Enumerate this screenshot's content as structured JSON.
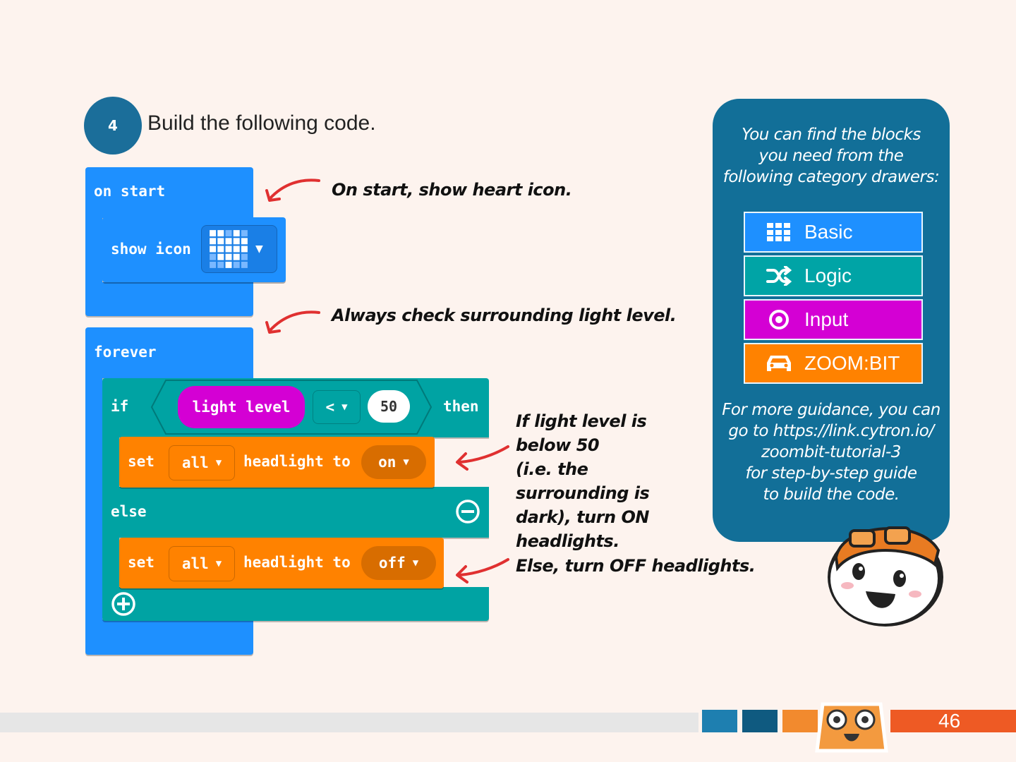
{
  "step": {
    "number": "4",
    "title": "Build the following code."
  },
  "blocks": {
    "on_start": "on start",
    "show_icon": "show icon",
    "forever": "forever",
    "if": "if",
    "light_level": "light level",
    "compare_op": "<",
    "threshold": "50",
    "then": "then",
    "else": "else",
    "set_on": {
      "set": "set",
      "target": "all",
      "headlight_to": "headlight to",
      "value": "on"
    },
    "set_off": {
      "set": "set",
      "target": "all",
      "headlight_to": "headlight to",
      "value": "off"
    }
  },
  "annotations": {
    "on_start": "On start, show heart icon.",
    "forever": "Always check surrounding light level.",
    "if_line1": "If light level is below 50",
    "if_line2": "(i.e. the surrounding is",
    "if_line3": "dark), turn ON",
    "if_line4": "headlights.",
    "else": "Else, turn OFF headlights."
  },
  "panel": {
    "intro_line1": "You can find the blocks",
    "intro_line2": "you need from the",
    "intro_line3": "following category drawers:",
    "categories": [
      {
        "label": "Basic",
        "color": "#1e90ff",
        "icon": "grid-icon"
      },
      {
        "label": "Logic",
        "color": "#00a4a6",
        "icon": "shuffle-icon"
      },
      {
        "label": "Input",
        "color": "#d400d4",
        "icon": "target-icon"
      },
      {
        "label": "ZOOM:BIT",
        "color": "#ff8200",
        "icon": "car-icon"
      }
    ],
    "guide_line1": "For more guidance, you can",
    "guide_line2": "go to https://link.cytron.io/",
    "guide_line3": "zoombit-tutorial-3",
    "guide_line4": "for step-by-step guide",
    "guide_line5": "to build the code."
  },
  "footer": {
    "page_number": "46"
  },
  "colors": {
    "block_blue": "#1e90ff",
    "block_teal": "#00a3a3",
    "block_orange": "#ff8200",
    "input_purple": "#d400d4",
    "panel": "#126f98",
    "arrow": "#e03030"
  }
}
